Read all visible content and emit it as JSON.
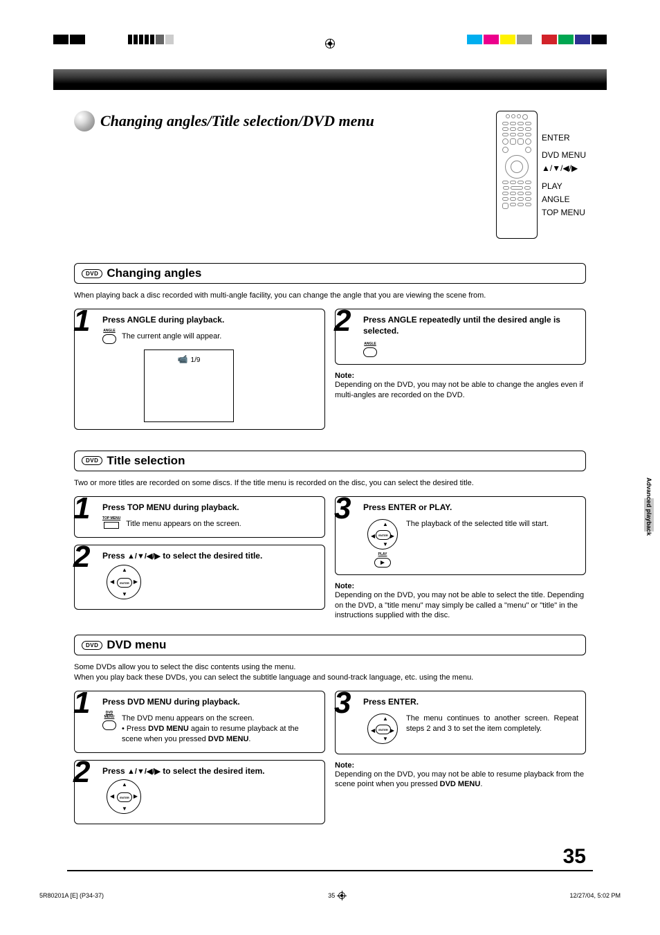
{
  "pageTitle": "Changing angles/Title selection/DVD menu",
  "remoteLabels": {
    "enter": "ENTER",
    "dvdmenu": "DVD MENU",
    "arrows": "▲/▼/◀/▶",
    "play": "PLAY",
    "angle": "ANGLE",
    "topmenu": "TOP MENU"
  },
  "sections": {
    "angles": {
      "badge": "DVD",
      "heading": "Changing angles",
      "intro": "When playing back a disc recorded with multi-angle facility, you can change the angle that you are viewing the scene from.",
      "step1": {
        "title": "Press ANGLE during playback.",
        "desc": "The current angle will appear.",
        "osd": "1/9",
        "btnLabel": "ANGLE"
      },
      "step2": {
        "title": "Press ANGLE repeatedly until the desired angle is selected.",
        "btnLabel": "ANGLE"
      },
      "noteLabel": "Note:",
      "note": "Depending on the DVD, you may not be able to change the angles even if multi-angles are recorded on the DVD."
    },
    "title": {
      "badge": "DVD",
      "heading": "Title selection",
      "intro": "Two or more titles are recorded on some discs. If the title menu is recorded on the disc, you can select the desired title.",
      "step1": {
        "title": "Press TOP MENU during playback.",
        "desc": "Title menu appears on the screen.",
        "btnLabel": "TOP MENU"
      },
      "step2": {
        "titlePrefix": "Press ",
        "titleArrows": "▲/▼/◀/▶",
        "titleSuffix": " to select the desired title."
      },
      "step3": {
        "title": "Press ENTER or PLAY.",
        "desc": "The playback of the selected title will start.",
        "playLabel": "PLAY"
      },
      "noteLabel": "Note:",
      "note": "Depending on the DVD, you may not be able to select the title. Depending on the DVD, a \"title menu\" may simply be called a \"menu\" or \"title\" in the instructions supplied with the disc."
    },
    "dvdmenu": {
      "badge": "DVD",
      "heading": "DVD menu",
      "intro1": "Some DVDs allow you to select the disc contents using the menu.",
      "intro2": "When you play back these DVDs, you can select the subtitle language and sound-track language, etc. using the menu.",
      "step1": {
        "title": "Press DVD MENU during playback.",
        "desc1": "The DVD menu appears on the screen.",
        "desc2a": "Press ",
        "desc2b": "DVD MENU",
        "desc2c": " again to resume playback at the scene when you pressed ",
        "desc2d": "DVD MENU",
        "desc2e": ".",
        "btnLabel": "DVD MENU"
      },
      "step2": {
        "titlePrefix": "Press ",
        "titleArrows": "▲/▼/◀/▶",
        "titleSuffix": " to select the desired item."
      },
      "step3": {
        "title": "Press ENTER.",
        "desc": "The menu continues to another screen. Repeat steps 2 and 3 to set the item completely."
      },
      "noteLabel": "Note:",
      "note1": "Depending on the DVD, you may not be able to resume playback from the scene point when you pressed ",
      "note2": "DVD MENU",
      "note3": "."
    }
  },
  "sideTab": "Advanced playback",
  "pageNumber": "35",
  "footer": {
    "left": "5R80201A [E] (P34-37)",
    "center": "35",
    "right": "12/27/04, 5:02 PM"
  },
  "dpadEnter": "ENTER"
}
